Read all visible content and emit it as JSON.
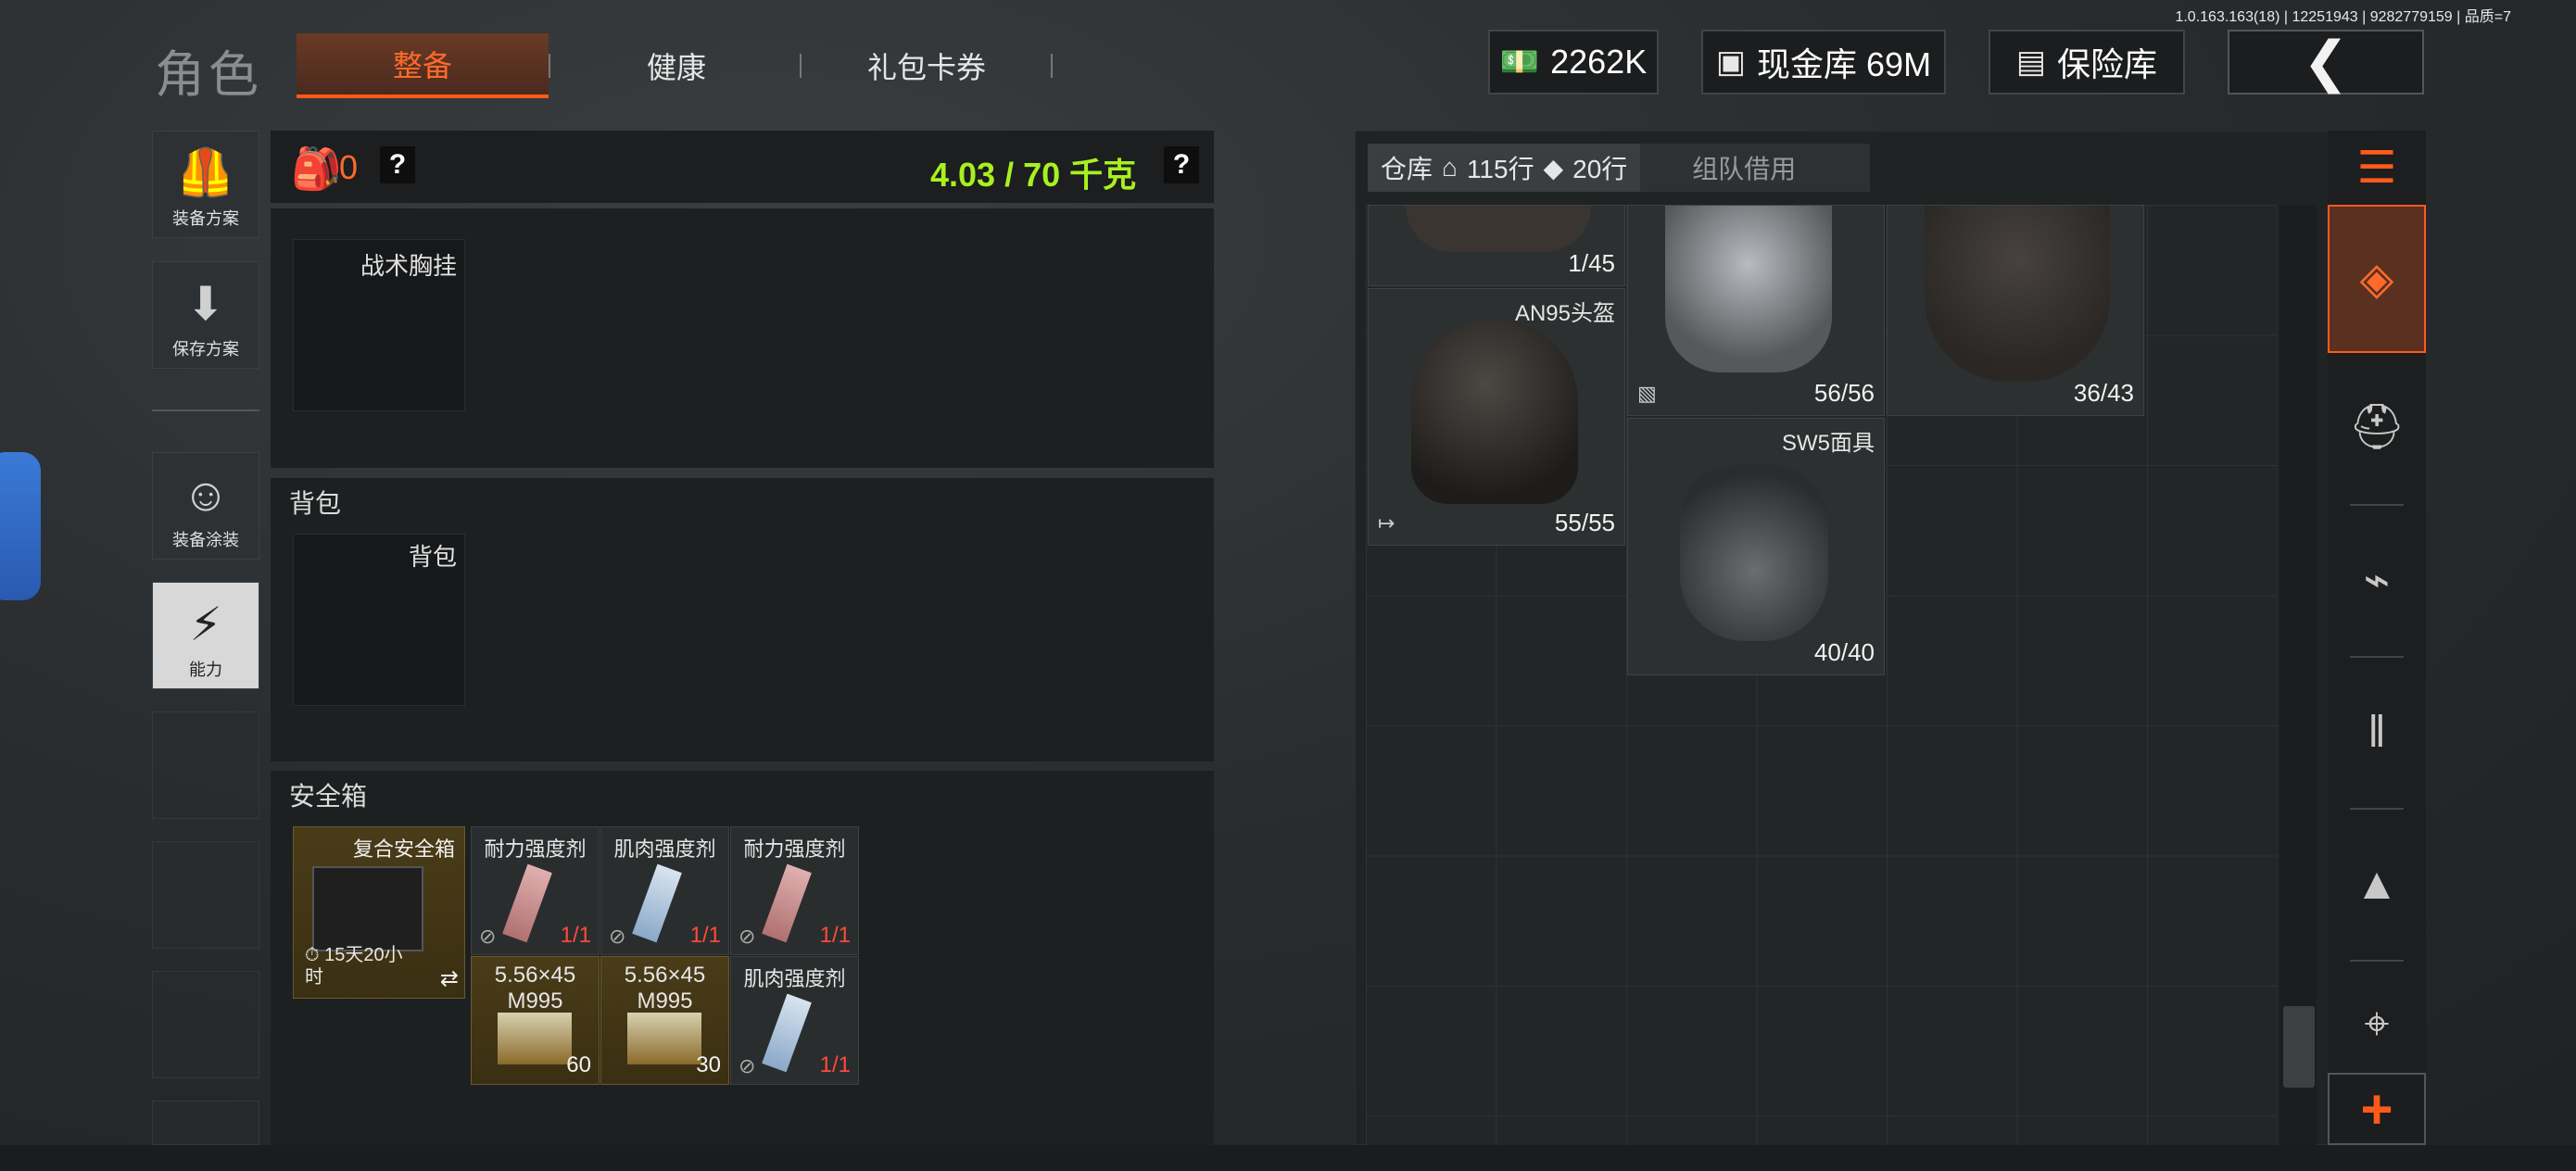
{
  "version": "1.0.163.163(18) | 12251943 | 9282779159 | 品质=7",
  "header": {
    "title": "角色",
    "tabs": [
      {
        "label": "整备",
        "active": true
      },
      {
        "label": "健康",
        "active": false
      },
      {
        "label": "礼包卡券",
        "active": false
      }
    ],
    "currency": "2262K",
    "cash_vault": "现金库 69M",
    "insurance": "保险库",
    "back_icon": "chevron-left-icon"
  },
  "sidebar": {
    "items": [
      {
        "label": "装备方案",
        "icon": "vest-icon"
      },
      {
        "label": "保存方案",
        "icon": "download-icon"
      },
      {
        "label": "装备涂装",
        "icon": "skin-icon"
      },
      {
        "label": "能力",
        "icon": "ability-icon",
        "active": true
      }
    ]
  },
  "loadout": {
    "bag_count": "0",
    "weight": "4.03 / 70 千克",
    "help": "?",
    "chest_rig_slot": "战术胸挂",
    "backpack_section": "背包",
    "backpack_slot": "背包",
    "safebox_section": "安全箱",
    "safebox": {
      "name": "复合安全箱",
      "timer": "15天20小时"
    },
    "safebox_items": [
      {
        "name": "耐力强度剂",
        "qty": "1/1"
      },
      {
        "name": "肌肉强度剂",
        "qty": "1/1"
      },
      {
        "name": "耐力强度剂",
        "qty": "1/1"
      },
      {
        "name": "5.56×45 M995",
        "qty": "60"
      },
      {
        "name": "5.56×45 M995",
        "qty": "30"
      },
      {
        "name": "肌肉强度剂",
        "qty": "1/1"
      }
    ]
  },
  "storage": {
    "tab_label": "仓库",
    "rows_home": "115行",
    "rows_ticket": "20行",
    "team_borrow": "组队借用",
    "items": [
      {
        "name": "",
        "durability": "1/45"
      },
      {
        "name": "",
        "durability": "56/56"
      },
      {
        "name": "",
        "durability": "36/43"
      },
      {
        "name": "AN95头盔",
        "durability": "55/55"
      },
      {
        "name": "SW5面具",
        "durability": "40/40"
      }
    ]
  },
  "rail": {
    "items": [
      "stack-refresh-icon",
      "layers-icon",
      "helmet-icon",
      "rifle-icon",
      "magazine-icon",
      "bullet-icon",
      "scope-icon"
    ],
    "add": "+"
  },
  "colors": {
    "accent": "#ff5a1a",
    "weight": "#a8f020",
    "qty_red": "#ff4a3a"
  }
}
